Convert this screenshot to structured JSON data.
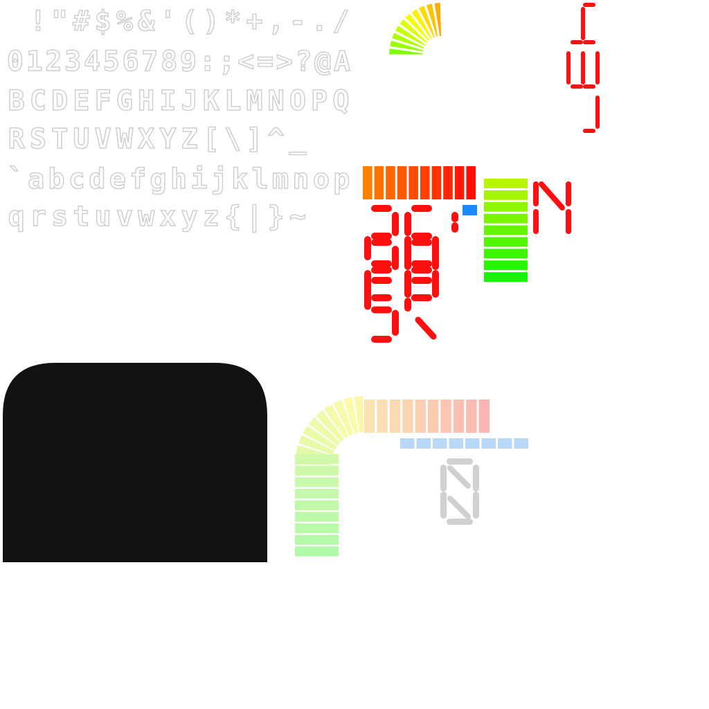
{
  "font_atlas": {
    "rows": [
      " !\"#$%&'()*+,-./",
      "0123456789:;<=>?@A",
      "BCDEFGHIJKLMNOPQ",
      "RSTUVWXYZ[\\]^_",
      "`abcdefghijklmnop",
      "qrstuvwxyz{|}~"
    ],
    "glyph_color": "#cfcfcf"
  },
  "colors": {
    "segment_red": "#ff1010",
    "panel_black": "#121212",
    "marker_blue": "#1e88ff",
    "pale_blue": "#b7d9f7",
    "pale_gray": "#d0d0d0"
  },
  "icons": {
    "rpm_arc_small": "rpm-arc-icon",
    "rpm_bar_horizontal": "rpm-bar-icon",
    "fuel_bar_vertical": "fuel-bar-icon",
    "rpm_arc_large": "rpm-arc-large-icon",
    "shift_light": "shift-light-icon"
  },
  "seven_segment": {
    "gear_vertical": "4",
    "digits_block": [
      "2",
      "6",
      "1",
      "2",
      "8",
      "0",
      "5",
      "0",
      "3",
      "R"
    ],
    "gear_indicator": "N",
    "dim_digit": "0"
  }
}
